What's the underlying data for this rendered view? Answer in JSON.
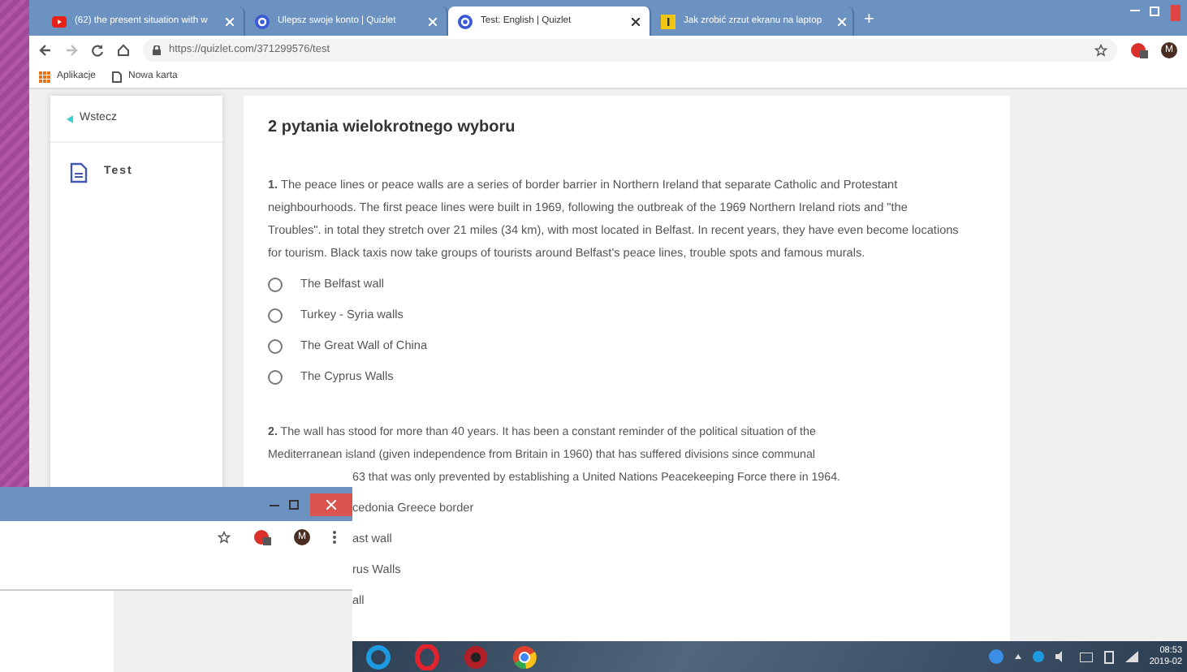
{
  "browser": {
    "tabs": [
      {
        "title": "(62) the present situation with w",
        "selected": false,
        "kind": "video"
      },
      {
        "title": "Ulepsz swoje konto | Quizlet",
        "selected": false,
        "kind": "quizlet"
      },
      {
        "title": "Test: English | Quizlet",
        "selected": true,
        "kind": "quizlet"
      },
      {
        "title": "Jak zrobić zrzut ekranu na laptop",
        "selected": false,
        "kind": "note"
      }
    ],
    "new_tab": "+",
    "url": "https://quizlet.com/371299576/test",
    "profile": "M",
    "bookmarks": [
      {
        "label": "Aplikacje",
        "kind": "apps"
      },
      {
        "label": "Nowa karta",
        "kind": "page"
      }
    ]
  },
  "sidebar": {
    "back": "Wstecz",
    "items": [
      {
        "label": "Test"
      }
    ]
  },
  "quiz": {
    "heading": "2 pytania wielokrotnego wyboru",
    "questions": [
      {
        "number": "1.",
        "text": "The peace lines or peace walls are a series of border barrier in Northern Ireland that separate Catholic and Protestant neighbourhoods. The first peace lines were built in 1969, following the outbreak of the 1969 Northern Ireland riots and \"the Troubles\". in total they stretch over 21 miles (34 km), with most located in Belfast. In recent years, they have even become locations for tourism. Black taxis now take groups of tourists around Belfast's peace lines, trouble spots and famous murals.",
        "options": [
          {
            "label": "The Belfast wall",
            "selected": false
          },
          {
            "label": "Turkey - Syria walls",
            "selected": false
          },
          {
            "label": "The Great Wall of China",
            "selected": false
          },
          {
            "label": "The Cyprus Walls",
            "selected": false
          }
        ]
      },
      {
        "number": "2.",
        "lines": [
          "The wall has stood for more than 40 years. It has been a constant reminder of the political situation of the",
          "Mediterranean island (given independence from Britain in 1960) that has suffered divisions since communal",
          "63 that was only prevented by establishing a United Nations Peacekeeping Force there in 1964."
        ],
        "options": [
          {
            "label": "cedonia Greece border"
          },
          {
            "label": "ast wall"
          },
          {
            "label": "rus Walls"
          },
          {
            "label": "all"
          }
        ]
      }
    ]
  },
  "second_window": {
    "profile": "M"
  },
  "taskbar": {
    "clock_time": "08:53",
    "clock_date": "2019-02"
  }
}
